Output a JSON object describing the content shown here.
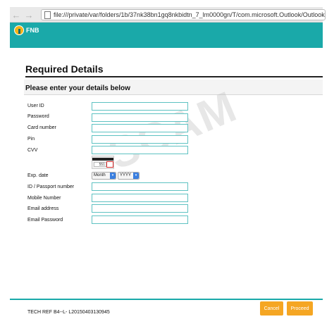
{
  "browser": {
    "back_icon": "arrow-left-icon",
    "forward_icon": "arrow-right-icon",
    "url": "file:///private/var/folders/1b/37nk38bn1gq8nkbidtn_7_lm0000gn/T/com.microsoft.Outlook/Outlook%20Temp/Ac"
  },
  "header": {
    "brand": "FNB",
    "brand_color": "#1aa9a9"
  },
  "page": {
    "title": "Required Details",
    "section_title": "Please enter your details below"
  },
  "fields": {
    "user_id": "User ID",
    "password": "Password",
    "card_number": "Card number",
    "pin": "Pin",
    "cvv": "CVV",
    "exp_date": "Exp. date",
    "id_passport": "ID / Passport number",
    "mobile": "Mobile Number",
    "email": "Email address",
    "email_password": "Email Password"
  },
  "cvv_card": {
    "number": "551"
  },
  "exp": {
    "month": "Month",
    "year": "YYYY"
  },
  "watermark": "SCAM",
  "footer": {
    "tech_ref": "TECH REF B4--L- L20150403130945"
  },
  "buttons": {
    "cancel": "Cancel",
    "proceed": "Proceed",
    "color": "#f5a623"
  }
}
